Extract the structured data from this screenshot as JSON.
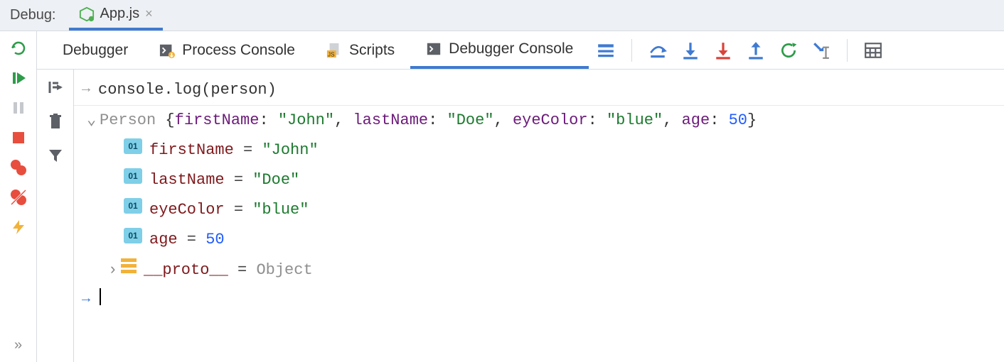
{
  "titleBar": {
    "label": "Debug:",
    "fileTab": {
      "name": "App.js"
    }
  },
  "tabs": {
    "debugger": "Debugger",
    "processConsole": "Process Console",
    "scripts": "Scripts",
    "debuggerConsole": "Debugger Console"
  },
  "console": {
    "command": "console.log(person)",
    "className": "Person",
    "summary": {
      "firstNameKey": "firstName",
      "firstNameVal": "\"John\"",
      "lastNameKey": "lastName",
      "lastNameVal": "\"Doe\"",
      "eyeColorKey": "eyeColor",
      "eyeColorVal": "\"blue\"",
      "ageKey": "age",
      "ageVal": "50"
    },
    "fields": [
      {
        "name": "firstName",
        "value": "\"John\"",
        "type": "string"
      },
      {
        "name": "lastName",
        "value": "\"Doe\"",
        "type": "string"
      },
      {
        "name": "eyeColor",
        "value": "\"blue\"",
        "type": "string"
      },
      {
        "name": "age",
        "value": "50",
        "type": "number"
      }
    ],
    "proto": {
      "name": "__proto__",
      "value": "Object"
    }
  }
}
